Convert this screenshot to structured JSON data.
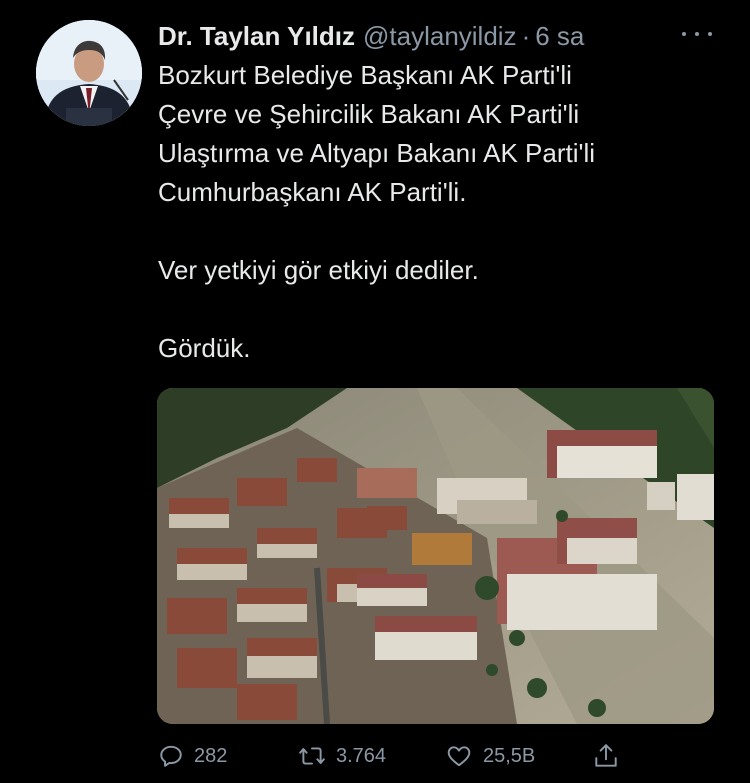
{
  "author": {
    "display_name": "Dr. Taylan Yıldız",
    "handle": "@taylanyildiz",
    "separator": "·",
    "time": "6 sa"
  },
  "tweet": {
    "lines": [
      "Bozkurt Belediye Başkanı AK Parti'li",
      "Çevre ve Şehircilik Bakanı AK Parti'li",
      "Ulaştırma ve Altyapı Bakanı AK Parti'li",
      "Cumhurbaşkanı AK Parti'li.",
      "",
      "Ver yetkiyi gör etkiyi dediler.",
      "",
      "Gördük."
    ]
  },
  "actions": {
    "reply_count": "282",
    "retweet_count": "3.764",
    "like_count": "25,5B"
  },
  "icons": {
    "more": "more-horizontal-icon",
    "reply": "reply-icon",
    "retweet": "retweet-icon",
    "like": "heart-icon",
    "share": "share-icon"
  },
  "colors": {
    "background": "#000000",
    "text": "#e7e9ea",
    "secondary": "#8b98a5"
  }
}
